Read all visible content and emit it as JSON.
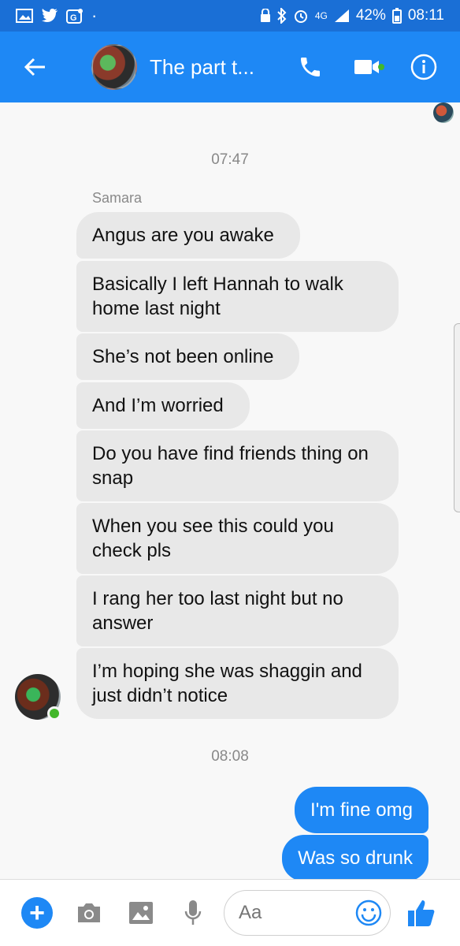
{
  "status_bar": {
    "battery": "42%",
    "time": "08:11",
    "network": "4G"
  },
  "header": {
    "title": "The part t..."
  },
  "chat": {
    "timestamp_1": "07:47",
    "sender": "Samara",
    "incoming": [
      "Angus are you awake",
      "Basically I left Hannah to walk home last night",
      "She’s not been online",
      "And I’m worried",
      "Do you have find friends thing on snap",
      "When you see this could you check pls",
      "I rang her too last night but no answer",
      "I’m hoping she was shaggin and just didn’t notice"
    ],
    "timestamp_2": "08:08",
    "outgoing": [
      "I'm fine omg",
      "Was so drunk"
    ]
  },
  "composer": {
    "placeholder": "Aa"
  },
  "icons": {
    "back": "back-arrow-icon",
    "call": "phone-icon",
    "video": "video-camera-icon",
    "info": "info-icon",
    "add": "plus-icon",
    "camera": "camera-icon",
    "gallery": "image-icon",
    "mic": "microphone-icon",
    "emoji": "emoji-icon",
    "like": "thumbs-up-icon"
  },
  "colors": {
    "header": "#1e88f5",
    "status_bar": "#1a6fd6",
    "incoming_bubble": "#e8e8e8",
    "outgoing_bubble": "#1e88f5",
    "online": "#42b72a"
  }
}
